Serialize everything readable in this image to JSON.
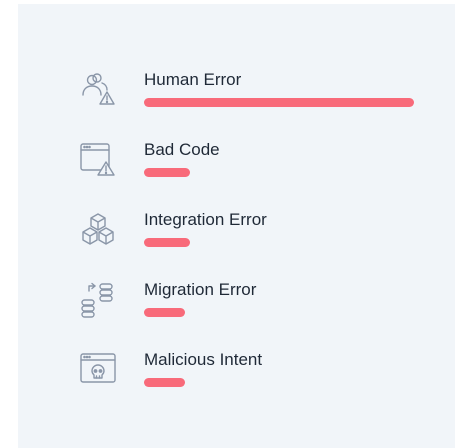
{
  "error_causes": {
    "accent_color": "#f86a7a",
    "items": [
      {
        "label": "Human Error",
        "icon": "user-warning-icon",
        "level_pct": 100
      },
      {
        "label": "Bad Code",
        "icon": "browser-warning-icon",
        "level_pct": 17
      },
      {
        "label": "Integration Error",
        "icon": "cubes-icon",
        "level_pct": 17
      },
      {
        "label": "Migration Error",
        "icon": "database-migration-icon",
        "level_pct": 15
      },
      {
        "label": "Malicious Intent",
        "icon": "browser-skull-icon",
        "level_pct": 15
      }
    ]
  }
}
